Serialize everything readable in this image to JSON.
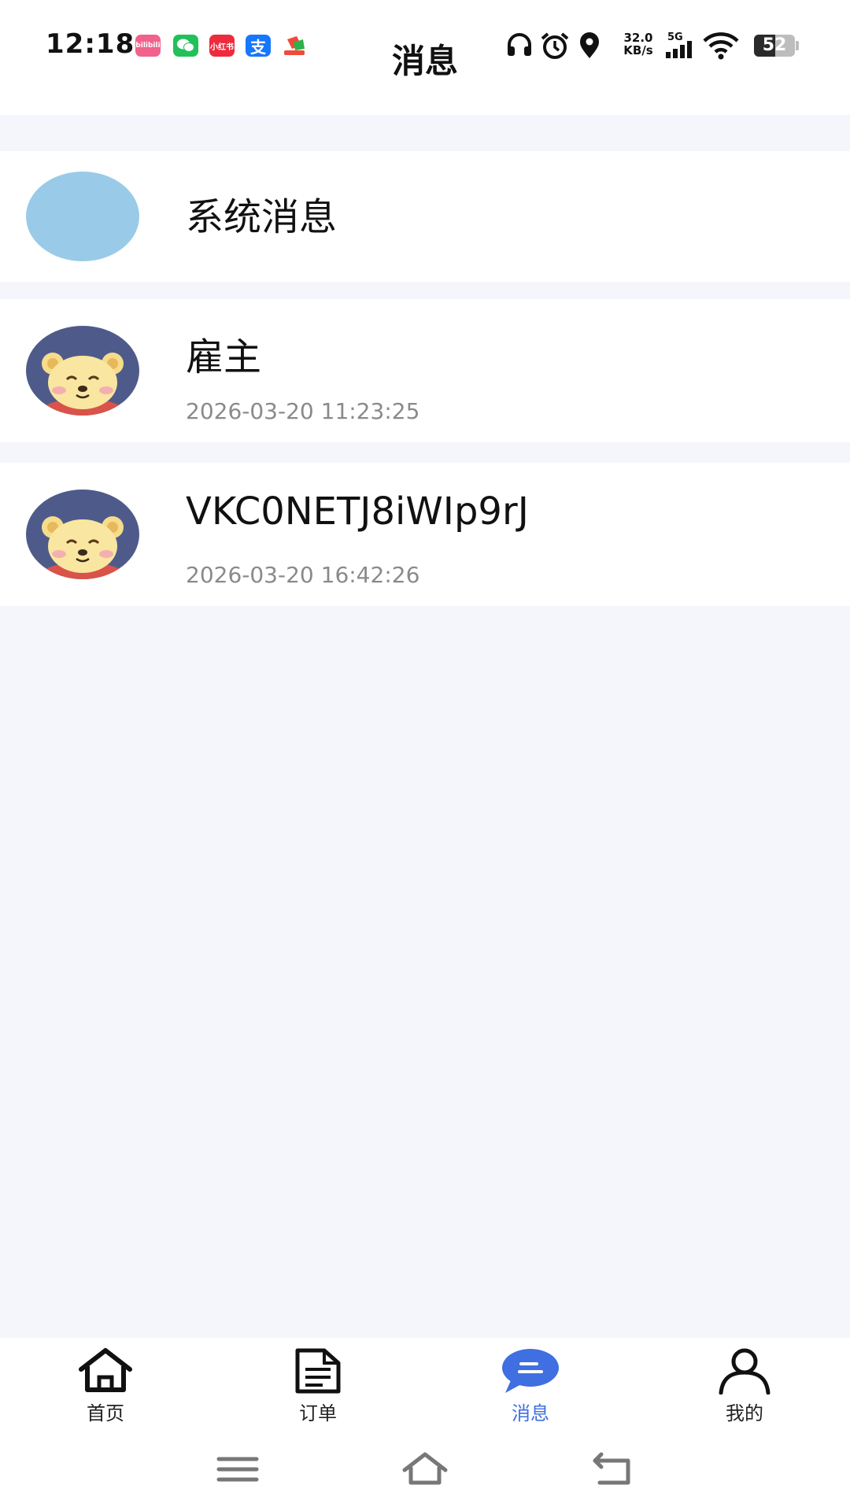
{
  "status_bar": {
    "time": "12:18",
    "app_icons": [
      {
        "name": "bilibili-icon",
        "label": "bilibili",
        "color": "#f0628c"
      },
      {
        "name": "wechat-icon",
        "label": "",
        "color": "#21c15a"
      },
      {
        "name": "xiaohongshu-icon",
        "label": "小红书",
        "color": "#ee2a3d"
      },
      {
        "name": "alipay-icon",
        "label": "支",
        "color": "#1677ff"
      },
      {
        "name": "app-icon",
        "label": "",
        "color": "#f04a3a"
      }
    ],
    "net_speed_value": "32.0",
    "net_speed_unit": "KB/s",
    "network": "5G",
    "battery": "52",
    "battery_level": 0.52
  },
  "header": {
    "title": "消息"
  },
  "messages": [
    {
      "title": "系统消息",
      "time": "",
      "avatar": "blank",
      "avatar_color": "#99cbe8"
    },
    {
      "title": "雇主",
      "time": "2026-03-20 11:23:25",
      "avatar": "bear"
    },
    {
      "title": "VKC0NETJ8iWIp9rJ",
      "time": "2026-03-20 16:42:26",
      "avatar": "bear"
    }
  ],
  "tabbar": {
    "tabs": [
      {
        "label": "首页",
        "icon": "home-icon",
        "active": false
      },
      {
        "label": "订单",
        "icon": "document-icon",
        "active": false
      },
      {
        "label": "消息",
        "icon": "chat-bubble-icon",
        "active": true
      },
      {
        "label": "我的",
        "icon": "person-icon",
        "active": false
      }
    ],
    "active_color": "#3f6fe0"
  },
  "system_nav": [
    "menu-icon",
    "home-outline-icon",
    "back-icon"
  ]
}
